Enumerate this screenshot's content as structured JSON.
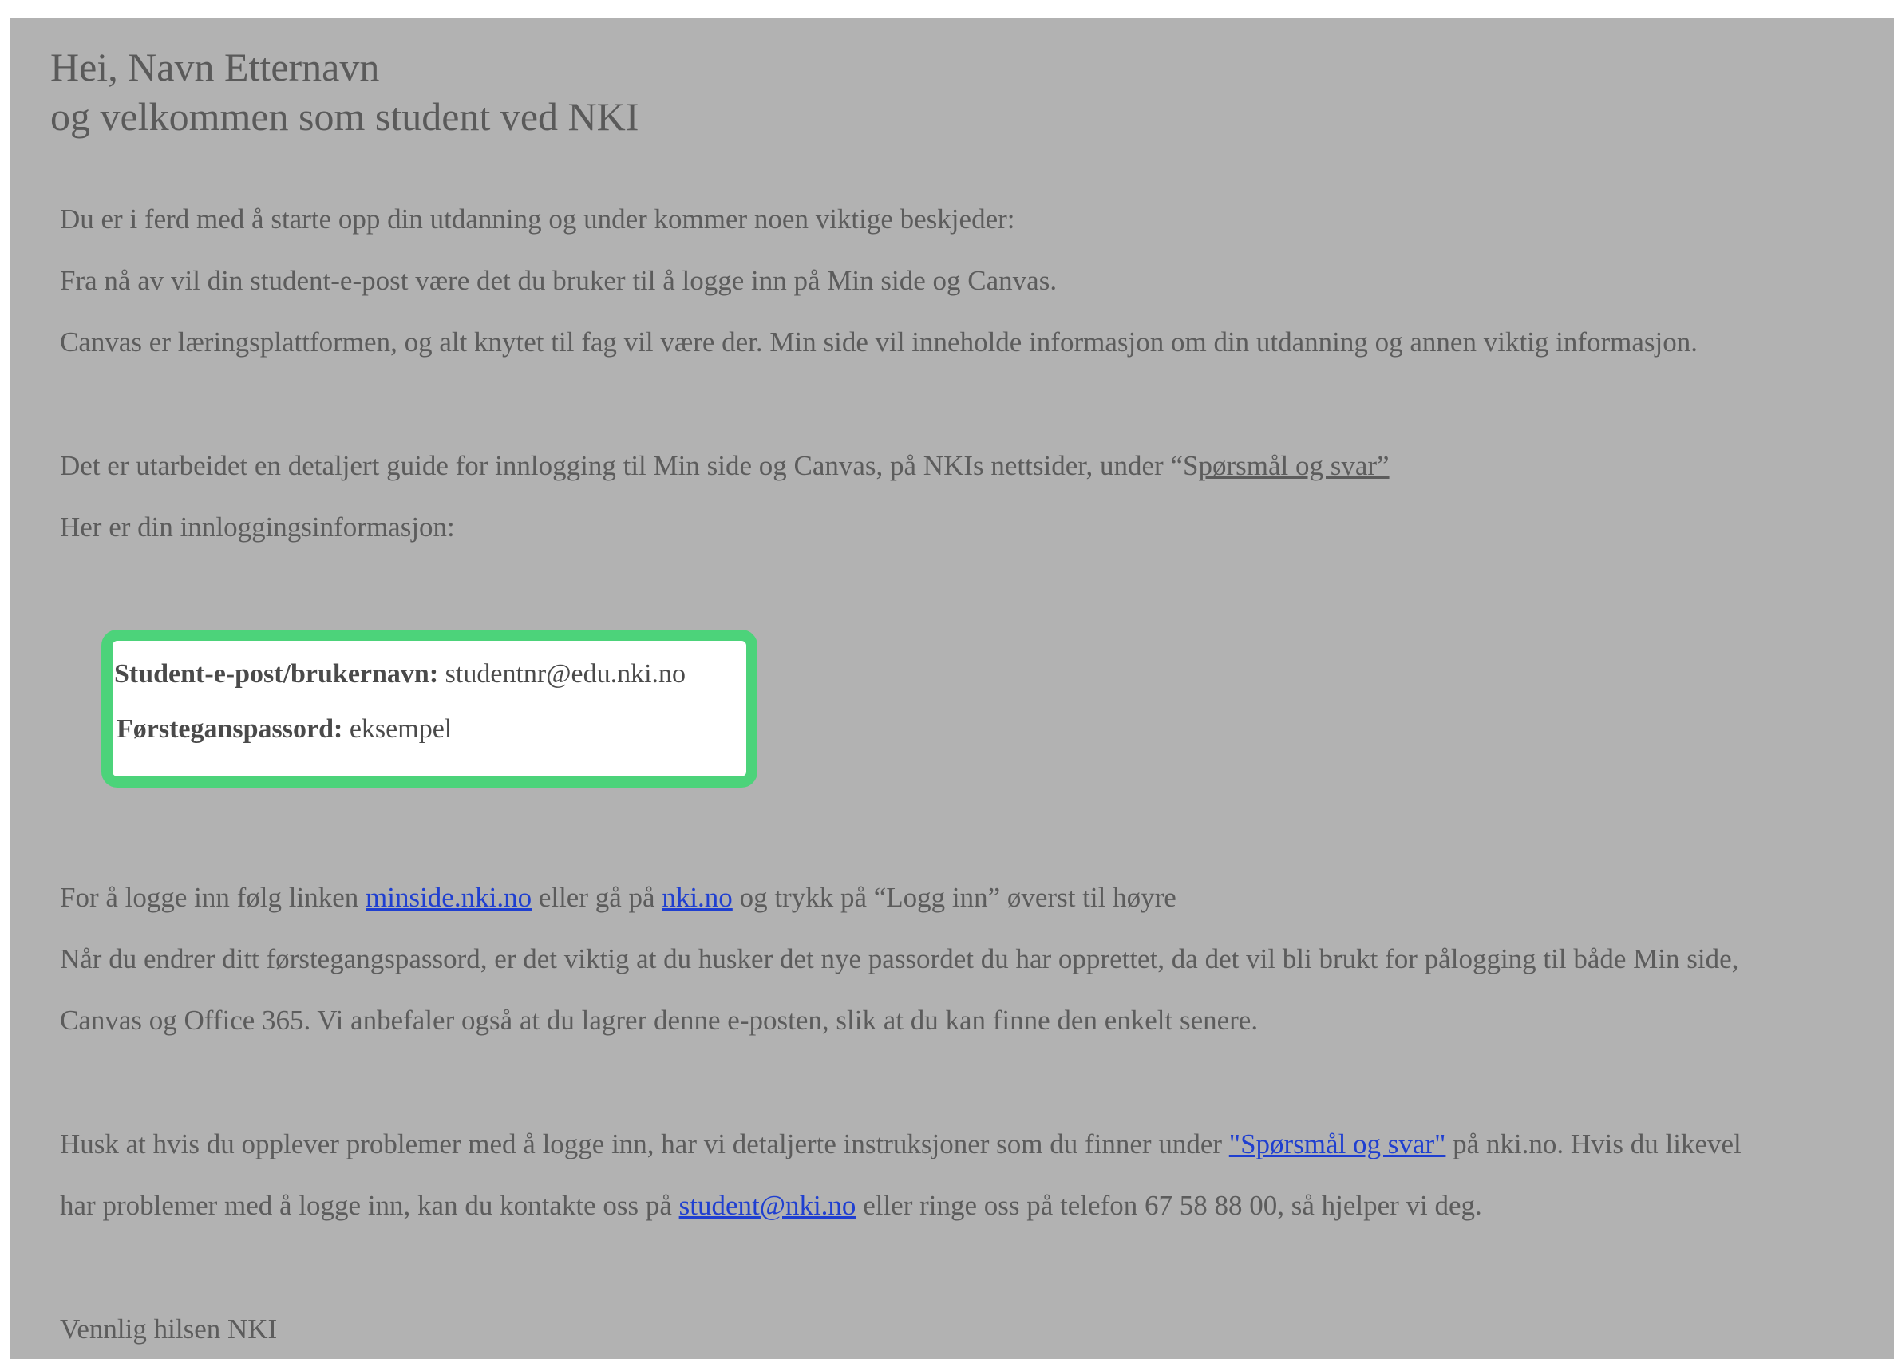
{
  "greeting": {
    "line1": "Hei, Navn Etternavn",
    "line2": "og velkommen som student ved NKI"
  },
  "intro": {
    "p1": "Du er i ferd med å starte opp din utdanning og under kommer noen viktige beskjeder:",
    "p2": "Fra nå av vil din student-e-post være det du bruker til å logge inn på Min side og Canvas.",
    "p3": "Canvas er læringsplattformen, og alt knytet til fag vil være der. Min side vil inneholde informasjon om din utdanning og annen viktig informasjon."
  },
  "guide": {
    "text_before": "Det er utarbeidet en detaljert guide for innlogging til Min side og Canvas, på NKIs nettsider, under “S",
    "link_text": "pørsmål og svar”",
    "login_info_label": "Her er din innloggingsinformasjon:"
  },
  "credentials": {
    "username_label": "Student-e-post/brukernavn:",
    "username_value": "studentnr@edu.nki.no",
    "password_label": "Førsteganspassord:",
    "password_value": "eksempel"
  },
  "login": {
    "text1": "For å logge inn følg linken ",
    "link1": "minside.nki.no",
    "text2": " eller gå på ",
    "link2": "nki.no",
    "text3": " og trykk på “Logg inn” øverst til høyre",
    "p2_line1": "Når du endrer ditt førstegangspassord, er det viktig at du husker det nye passordet du har opprettet, da det vil bli brukt for pålogging til både Min side,",
    "p2_line2": "Canvas og Office 365. Vi anbefaler også at du lagrer denne e-posten, slik at du kan finne den enkelt senere."
  },
  "help": {
    "text1": "Husk at hvis du opplever problemer med å logge inn, har vi detaljerte instruksjoner som du finner under ",
    "faq_link": "\"Spørsmål og svar\"",
    "text2": " på nki.no. Hvis du likevel",
    "text3": "har problemer med å logge inn, kan du kontakte oss på ",
    "email_link": "student@nki.no",
    "text4": " eller ringe oss på telefon 67 58 88 00, så hjelper vi deg."
  },
  "signoff": "Vennlig hilsen NKI",
  "colors": {
    "background": "#b2b2b2",
    "credential_border": "#4cd37a",
    "link": "#1f3fd0"
  }
}
